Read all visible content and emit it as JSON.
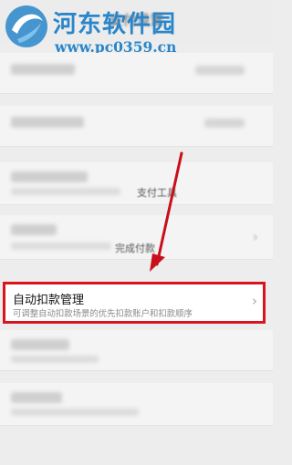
{
  "header": {
    "title": "支付设置"
  },
  "watermark": {
    "name": "河东软件园",
    "url": "www.pc0359.cn"
  },
  "mid_fragments": {
    "line1": "支付工具",
    "line2": "完成付款"
  },
  "highlight": {
    "title": "自动扣款管理",
    "subtitle": "可调整自动扣款场景的优先扣款账户和扣款顺序"
  },
  "colors": {
    "highlight_border": "#d8141f",
    "arrow": "#c8101a",
    "watermark": "#2a86c9"
  }
}
